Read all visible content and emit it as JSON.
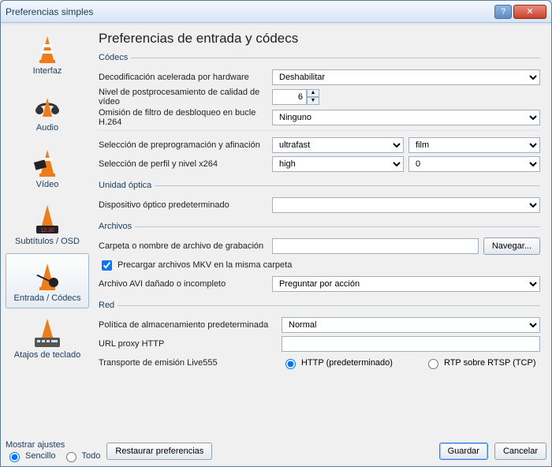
{
  "window": {
    "title": "Preferencias simples"
  },
  "sidebar": {
    "items": [
      {
        "label": "Interfaz"
      },
      {
        "label": "Audio"
      },
      {
        "label": "Vídeo"
      },
      {
        "label": "Subtítulos / OSD"
      },
      {
        "label": "Entrada / Códecs"
      },
      {
        "label": "Atajos de teclado"
      }
    ],
    "selected_index": 4
  },
  "main": {
    "title": "Preferencias de entrada y códecs",
    "codecs": {
      "legend": "Códecs",
      "hwdecode_label": "Decodificación acelerada por hardware",
      "hwdecode_value": "Deshabilitar",
      "postproc_label": "Nivel de postprocesamiento de calidad de vídeo",
      "postproc_value": "6",
      "h264loop_label": "Omisión de filtro de desbloqueo en bucle H.264",
      "h264loop_value": "Ninguno",
      "preprog_label": "Selección de preprogramación y afinación",
      "preprog_preset": "ultrafast",
      "preprog_tune": "film",
      "x264_label": "Selección de perfil y nivel x264",
      "x264_profile": "high",
      "x264_level": "0"
    },
    "optical": {
      "legend": "Unidad óptica",
      "device_label": "Dispositivo óptico predeterminado",
      "device_value": ""
    },
    "files": {
      "legend": "Archivos",
      "recfolder_label": "Carpeta o nombre de archivo de grabación",
      "recfolder_value": "",
      "browse_label": "Navegar...",
      "preload_label": "Precargar archivos MKV en la misma carpeta",
      "preload_checked": true,
      "avi_label": "Archivo AVI dañado o incompleto",
      "avi_value": "Preguntar por acción"
    },
    "net": {
      "legend": "Red",
      "cache_label": "Política de almacenamiento predeterminada",
      "cache_value": "Normal",
      "proxy_label": "URL proxy HTTP",
      "proxy_value": "",
      "live555_label": "Transporte de emisión Live555",
      "live555_http": "HTTP (predeterminado)",
      "live555_rtp": "RTP sobre RTSP (TCP)",
      "live555_selected": "http"
    }
  },
  "footer": {
    "show_label": "Mostrar ajustes",
    "simple": "Sencillo",
    "all": "Todo",
    "selected": "simple",
    "reset": "Restaurar preferencias",
    "save": "Guardar",
    "cancel": "Cancelar"
  }
}
